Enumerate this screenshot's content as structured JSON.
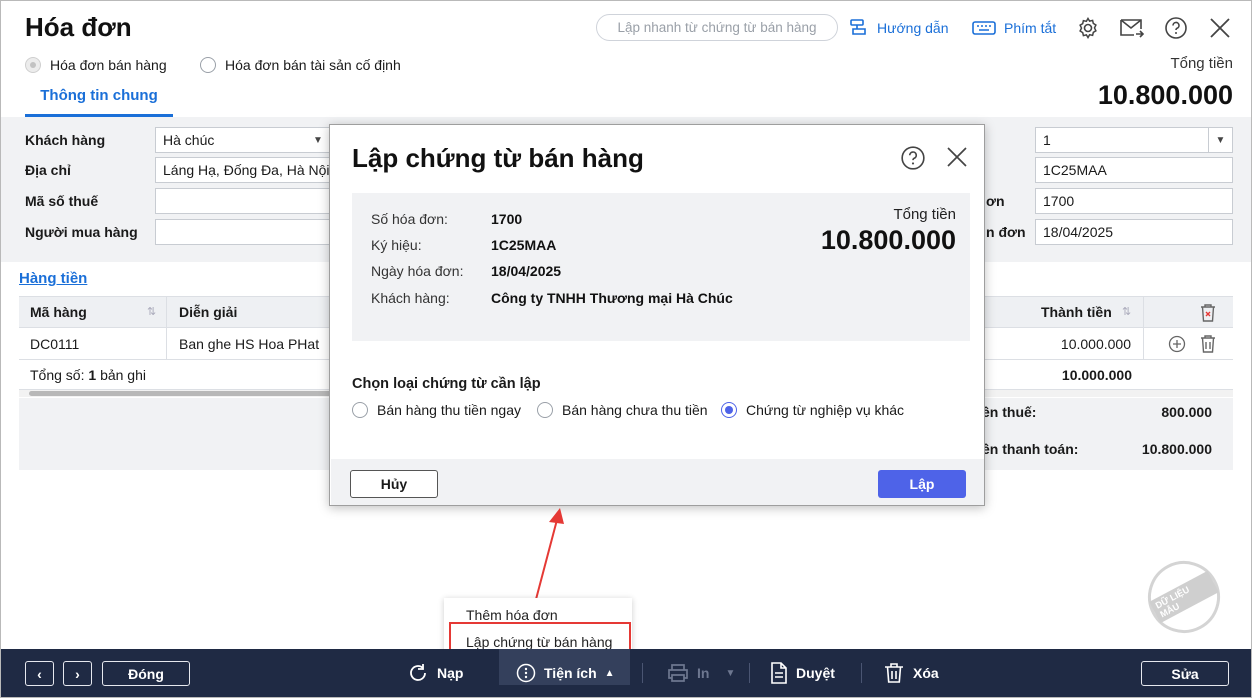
{
  "header": {
    "title": "Hóa đơn",
    "quick_search_placeholder": "Lập nhanh từ chứng từ bán hàng",
    "guide_label": "Hướng dẫn",
    "shortcut_label": "Phím tắt"
  },
  "invoice_types": [
    {
      "label": "Hóa đơn bán hàng",
      "selected": true
    },
    {
      "label": "Hóa đơn bán tài sản cố định",
      "selected": false
    }
  ],
  "tabs": [
    {
      "label": "Thông tin chung",
      "active": true
    }
  ],
  "total": {
    "label": "Tổng tiền",
    "value": "10.800.000"
  },
  "form": {
    "customer_label": "Khách hàng",
    "customer_value": "Hà chúc",
    "address_label": "Địa chỉ",
    "address_value": "Láng Hạ, Đống Đa, Hà Nội",
    "tax_code_label": "Mã số thuế",
    "buyer_label": "Người mua hàng",
    "right_values": [
      "1",
      "1C25MAA",
      "1700",
      "18/04/2025"
    ],
    "right_label_fragments": [
      "ơn",
      "n đơn"
    ]
  },
  "section_link": "Hàng tiền",
  "grid": {
    "columns": [
      "Mã hàng",
      "Diễn giải",
      "Thành tiền"
    ],
    "rows": [
      {
        "code": "DC0111",
        "description": "Ban ghe HS Hoa PHat",
        "amount": "10.000.000"
      }
    ],
    "footer_prefix": "Tổng số:",
    "footer_count": "1",
    "footer_suffix": "bản ghi",
    "footer_total": "10.000.000"
  },
  "summary": {
    "tax_label": "ền thuế:",
    "tax_value": "800.000",
    "payment_label": "ền thanh toán:",
    "payment_value": "10.800.000"
  },
  "dialog": {
    "title": "Lập chứng từ bán hàng",
    "info": [
      {
        "key": "Số hóa đơn:",
        "value": "1700"
      },
      {
        "key": "Ký hiệu:",
        "value": "1C25MAA"
      },
      {
        "key": "Ngày hóa đơn:",
        "value": "18/04/2025"
      },
      {
        "key": "Khách hàng:",
        "value": "Công ty TNHH Thương mại Hà Chúc"
      }
    ],
    "total_label": "Tổng tiền",
    "total_value": "10.800.000",
    "choose_label": "Chọn loại chứng từ cần lập",
    "options": [
      {
        "label": "Bán hàng thu tiền ngay",
        "selected": false
      },
      {
        "label": "Bán hàng chưa thu tiền",
        "selected": false
      },
      {
        "label": "Chứng từ nghiệp vụ khác",
        "selected": true
      }
    ],
    "cancel_label": "Hủy",
    "submit_label": "Lập"
  },
  "popup_menu": [
    "Thêm hóa đơn",
    "Lập chứng từ bán hàng"
  ],
  "toolbar": {
    "close_label": "Đóng",
    "reload_label": "Nạp",
    "utilities_label": "Tiện ích",
    "print_label": "In",
    "approve_label": "Duyệt",
    "delete_label": "Xóa",
    "edit_label": "Sửa"
  },
  "watermark": "DỮ LIỆU MẪU",
  "colors": {
    "accent": "#4e63e8",
    "link": "#1a6fd8",
    "toolbar": "#1f2a44",
    "highlight": "#e53935"
  }
}
